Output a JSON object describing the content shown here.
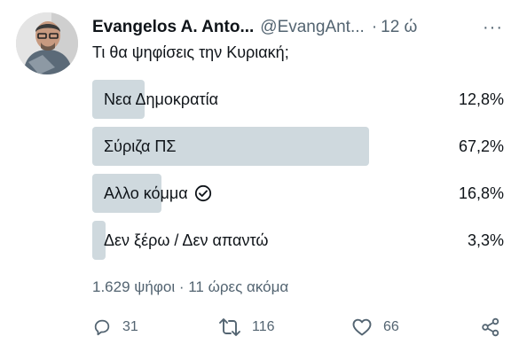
{
  "author": {
    "display_name": "Evangelos A. Anto...",
    "handle": "@EvangAnt...",
    "separator": "·",
    "time": "12 ώ",
    "more_label": "···"
  },
  "tweet": {
    "text": "Τι θα ψηφίσεις την Κυριακή;"
  },
  "poll": {
    "options": [
      {
        "label": "Νεα Δημοκρατία",
        "percent": "12,8%",
        "share": 0.128
      },
      {
        "label": "Σύριζα ΠΣ",
        "percent": "67,2%",
        "share": 0.672
      },
      {
        "label": "Αλλο κόμμα",
        "percent": "16,8%",
        "share": 0.168,
        "voted": true
      },
      {
        "label": "Δεν ξέρω / Δεν απαντώ",
        "percent": "3,3%",
        "share": 0.033
      }
    ],
    "meta": "1.629 ψήφοι · 11 ώρες ακόμα"
  },
  "actions": {
    "replies": "31",
    "retweets": "116",
    "likes": "66"
  },
  "colors": {
    "bar": "#cfd9de",
    "muted": "#536471",
    "text": "#0f1419"
  }
}
